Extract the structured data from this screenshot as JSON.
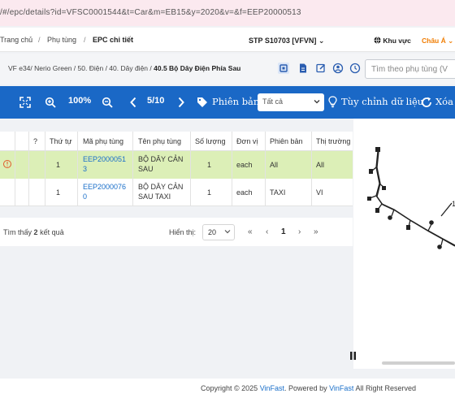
{
  "browser": {
    "url": "/#/epc/details?id=VFSC0001544&t=Car&m=EB15&y=2020&v=&f=EEP20000513"
  },
  "navbar": {
    "breadcrumb": [
      "Trang chủ",
      "Phụ tùng",
      "EPC chi tiết"
    ],
    "store": "STP S10703 [VFVN]",
    "region": "Khu vực",
    "language": "Châu Á"
  },
  "subbar": {
    "path": [
      "VF e34/ Nerio Green",
      "50. Điện",
      "40. Dây điện"
    ],
    "current": "40.5 Bộ Dây Điện Phía Sau",
    "search_placeholder": "Tìm theo phụ tùng (V"
  },
  "toolbar": {
    "zoom": "100%",
    "page": "5/10",
    "version_label": "Phiên bản",
    "version_value": "Tất cả",
    "customize_label": "Tùy chỉnh dữ liệu",
    "delete_label": "Xóa"
  },
  "table": {
    "headers": [
      "?",
      "Thứ tự",
      "Mã phụ tùng",
      "Tên phụ tùng",
      "Số lượng",
      "Đơn vị",
      "Phiên bản",
      "Thị trường"
    ],
    "rows": [
      {
        "order": "1",
        "code1": "EEP2000051",
        "code2": "3",
        "name1": "BỘ DÂY CẢN",
        "name2": "SAU",
        "qty": "1",
        "unit": "each",
        "version": "All",
        "market": "All"
      },
      {
        "order": "1",
        "code1": "EEP2000076",
        "code2": "0",
        "name1": "BỘ DÂY CẢN",
        "name2": "SAU TAXI",
        "qty": "1",
        "unit": "each",
        "version": "TAXI",
        "market": "VI"
      }
    ]
  },
  "pager": {
    "found_prefix": "Tìm thấy",
    "found_count": "2",
    "found_suffix": "kết quả",
    "show_label": "Hiển thị:",
    "per_page": "20",
    "current_page": "1",
    "first": "«",
    "prev": "‹",
    "next": "›",
    "last": "»"
  },
  "diagram": {
    "callout": "1"
  },
  "footer": {
    "prefix": "Copyright © 2025 ",
    "brand1": "VinFast",
    "middle": ". Powered by ",
    "brand2": "VinFast",
    "suffix": " All Right Reserved"
  },
  "colors": {
    "toolbar": "#1a68c6",
    "highlight_row": "#dcefb7",
    "link": "#1a6fc9",
    "accent": "#f07c00",
    "warning": "#e05a2b"
  },
  "icons": [
    "fullscreen-icon",
    "zoom-in-icon",
    "zoom-out-icon",
    "prev-icon",
    "next-icon",
    "bulb-icon",
    "refresh-icon",
    "globe-icon",
    "warning-icon",
    "pause-icon"
  ]
}
